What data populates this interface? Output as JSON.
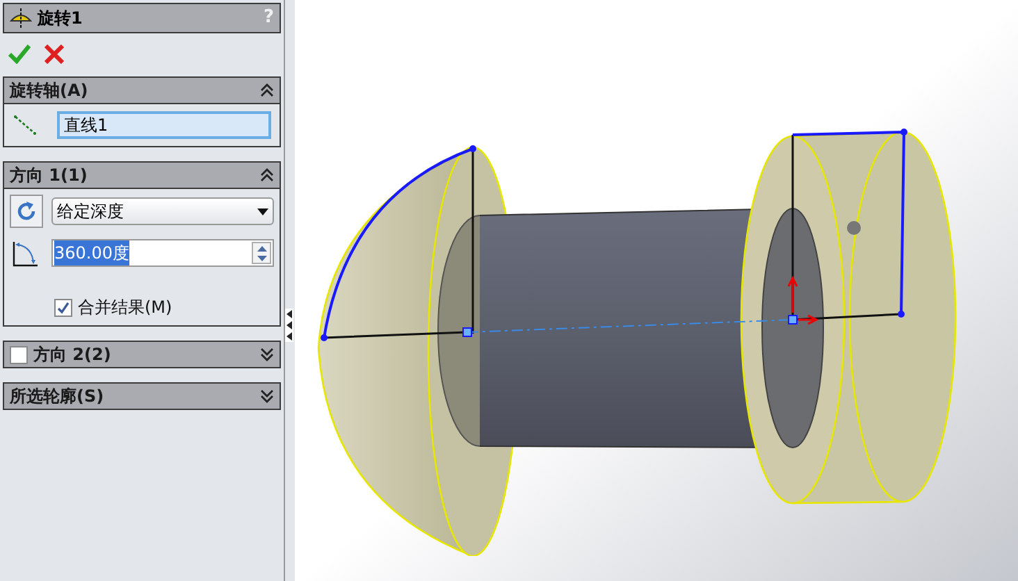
{
  "property_manager": {
    "title": "旋转1",
    "help": "?"
  },
  "sections": [
    {
      "kind": "axis",
      "title": "旋转轴(A)",
      "expanded": true,
      "field": {
        "value": "直线1",
        "active": true
      }
    },
    {
      "kind": "direction",
      "title": "方向 1(1)",
      "expanded": true,
      "end_condition": "给定深度",
      "angle": {
        "value": "360.00度",
        "highlighted": true
      },
      "merge": {
        "label": "合并结果(M)",
        "checked": true
      }
    },
    {
      "kind": "toggle",
      "title": "方向 2(2)",
      "expanded": false,
      "checked": false
    },
    {
      "kind": "plain",
      "title": "所选轮廓(S)",
      "expanded": false
    }
  ]
}
